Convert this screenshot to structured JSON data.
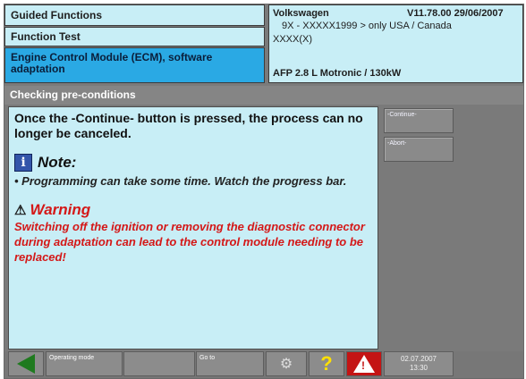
{
  "header": {
    "nav": [
      "Guided Functions",
      "Function Test"
    ],
    "selected_item": "Engine Control Module (ECM), software adaptation",
    "brand": "Volkswagen",
    "version": "V11.78.00 29/06/2007",
    "model_line": "9X - XXXXX1999 > only USA / Canada",
    "model_code": "XXXX(X)",
    "engine": "AFP 2.8 L Motronic / 130kW"
  },
  "title": "Checking pre-conditions",
  "content": {
    "intro": "Once the -Continue- button is pressed, the process can no longer be canceled.",
    "note_title": "Note:",
    "note_text": "• Programming can take some time. Watch the progress bar.",
    "warning_title": "Warning",
    "warning_text": "Switching off the ignition or removing the diagnostic connector during adaptation can lead to the control module needing to be replaced!"
  },
  "side_buttons": {
    "continue": "-Continue-",
    "abort": "-Abort-"
  },
  "bottom_bar": {
    "operating_mode": "Operating mode",
    "go_to": "Go to",
    "help_glyph": "?",
    "warning_glyph": "!",
    "date": "02.07.2007",
    "time": "13:30"
  },
  "icons": {
    "back": "back-arrow-icon",
    "tools": "tools-icon",
    "help": "help-icon",
    "warning": "warning-icon",
    "note": "info-icon"
  },
  "colors": {
    "panel": "#c8eef6",
    "selected": "#2aa9e4",
    "warning_text": "#d41818",
    "back_arrow": "#1f7a1f",
    "help": "#ffe000",
    "warning_button": "#c41414"
  }
}
